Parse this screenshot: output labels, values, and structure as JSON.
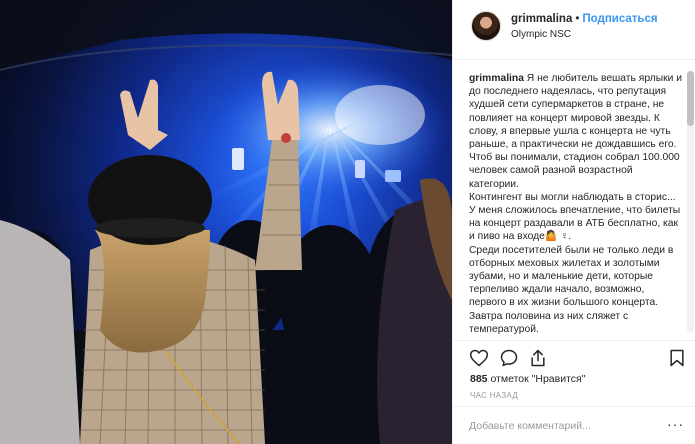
{
  "post": {
    "username": "grimmalina",
    "separator": "•",
    "follow_label": "Подписаться",
    "location": "Olympic NSC",
    "caption_user": "grimmalina",
    "caption_text": " Я не любитель вешать ярлыки и до последнего надеялась, что репутация худшей сети супермаркетов в стране, не повлияет на концерт мировой звезды. К слову, я впервые ушла с концерта не чуть раньше, а практически не дождавшись его.\nЧтоб вы понимали, стадион собрал 100.000 человек самой разной возрастной категории.\nКонтингент вы могли наблюдать в сторис... У меня сложилось впечатление, что билеты на концерт раздавали в АТБ бесплатно, как и пиво на входе🤷 ♀.\nСреди посетителей были не только леди в отборных меховых жилетах и золотыми зубами, но и маленькие дети, которые терпеливо ждали начало, возможно, первого в их жизни большого концерта. Завтра половина из них сляжет с температурой.",
    "likes_count": "885",
    "likes_word": "отметок",
    "likes_suffix": "\"Нравится\"",
    "time_ago": "ЧАС НАЗАД",
    "comment_placeholder": "Добавьте комментарий...",
    "more_label": "···"
  },
  "icons": {
    "like": "heart-icon",
    "comment": "comment-icon",
    "share": "share-icon",
    "save": "bookmark-icon"
  },
  "colors": {
    "accent": "#3897f0",
    "text": "#262626",
    "muted": "#999999",
    "border": "#efefef"
  }
}
